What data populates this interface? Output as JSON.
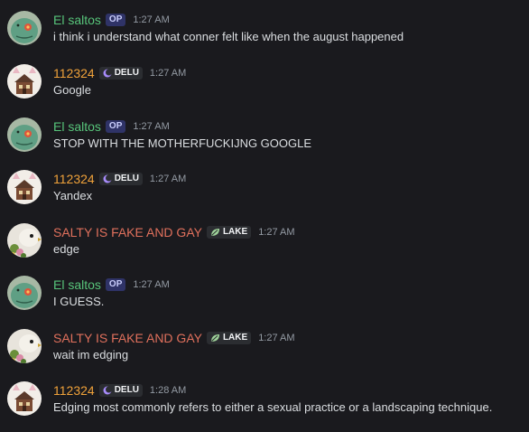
{
  "users": {
    "elsaltos": {
      "name": "El saltos",
      "color": "#57c47a",
      "tag": "OP"
    },
    "u112324": {
      "name": "112324",
      "color": "#f0a23a",
      "guild_tag": "DELU"
    },
    "salty": {
      "name": "SALTY IS FAKE AND GAY",
      "color": "#e0705c",
      "guild_tag": "LAKE"
    }
  },
  "messages": [
    {
      "author": "El saltos",
      "badge": "OP",
      "time": "1:27 AM",
      "text": "i think i understand what conner felt like when the august happened"
    },
    {
      "author": "112324",
      "badge": "DELU",
      "time": "1:27 AM",
      "text": "Google"
    },
    {
      "author": "El saltos",
      "badge": "OP",
      "time": "1:27 AM",
      "text": "STOP WITH THE MOTHERFUCKIJNG GOOGLE"
    },
    {
      "author": "112324",
      "badge": "DELU",
      "time": "1:27 AM",
      "text": "Yandex"
    },
    {
      "author": "SALTY IS FAKE AND GAY",
      "badge": "LAKE",
      "time": "1:27 AM",
      "text": "edge"
    },
    {
      "author": "El saltos",
      "badge": "OP",
      "time": "1:27 AM",
      "text": "I GUESS."
    },
    {
      "author": "SALTY IS FAKE AND GAY",
      "badge": "LAKE",
      "time": "1:27 AM",
      "text": "wait im edging"
    },
    {
      "author": "112324",
      "badge": "DELU",
      "time": "1:28 AM",
      "text": "Edging most commonly refers to either a sexual practice or a landscaping technique."
    }
  ],
  "icons": {
    "delu_tag_icon": "moon-icon",
    "lake_tag_icon": "leaf-icon"
  }
}
